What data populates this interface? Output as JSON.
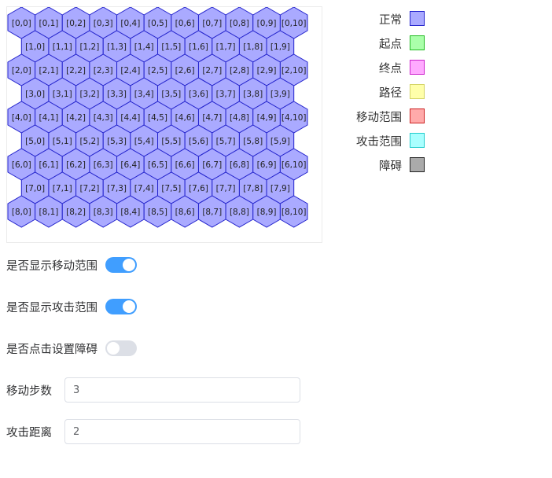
{
  "grid": {
    "rows": 9,
    "cols_even_row": 11,
    "cols_odd_row": 10,
    "cell_fill": "#aaaaff",
    "cell_stroke": "#2323cc"
  },
  "legend": [
    {
      "label": "正常",
      "fill": "#aaaaff",
      "stroke": "#2323cc"
    },
    {
      "label": "起点",
      "fill": "#aaffaa",
      "stroke": "#22bb22"
    },
    {
      "label": "终点",
      "fill": "#ffaaff",
      "stroke": "#cc22cc"
    },
    {
      "label": "路径",
      "fill": "#ffffaa",
      "stroke": "#d4d466"
    },
    {
      "label": "移动范围",
      "fill": "#ffaaaa",
      "stroke": "#cc2222"
    },
    {
      "label": "攻击范围",
      "fill": "#aaffff",
      "stroke": "#22cccc"
    },
    {
      "label": "障碍",
      "fill": "#aaaaaa",
      "stroke": "#222222"
    }
  ],
  "controls": {
    "show_move_range": {
      "label": "是否显示移动范围",
      "on": true
    },
    "show_attack_range": {
      "label": "是否显示攻击范围",
      "on": true
    },
    "click_set_obstacle": {
      "label": "是否点击设置障碍",
      "on": false
    },
    "move_steps": {
      "label": "移动步数",
      "value": "3"
    },
    "attack_distance": {
      "label": "攻击距离",
      "value": "2"
    }
  }
}
